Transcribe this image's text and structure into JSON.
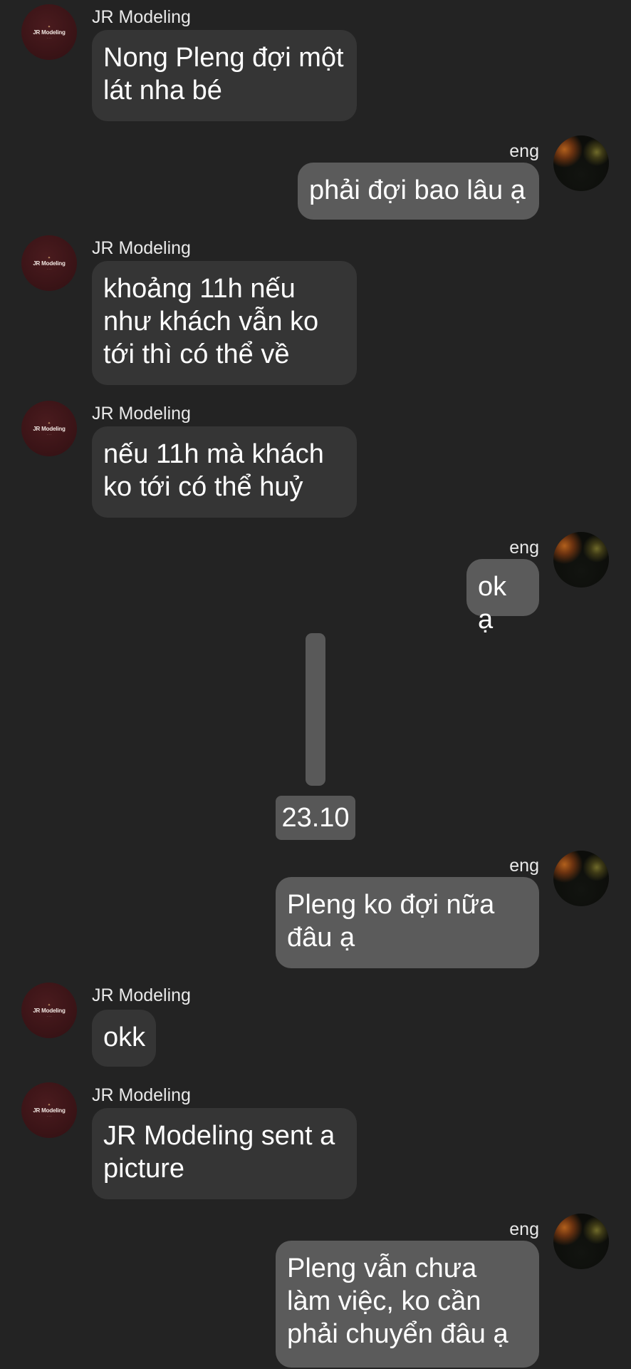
{
  "conversation": {
    "date_divider": "23.10",
    "messages": [
      {
        "sender": "JR Modeling",
        "direction": "in",
        "text": "Nong Pleng đợi một lát nha bé"
      },
      {
        "sender": "eng",
        "direction": "out",
        "text": "phải đợi bao lâu ạ"
      },
      {
        "sender": "JR Modeling",
        "direction": "in",
        "text": "khoảng 11h nếu như khách vẫn ko tới thì có thể về"
      },
      {
        "sender": "JR Modeling",
        "direction": "in",
        "text": "nếu 11h mà khách ko tới có thể huỷ"
      },
      {
        "sender": "eng",
        "direction": "out",
        "text": "ok ạ"
      },
      {
        "sender": "eng",
        "direction": "out",
        "text": "Pleng ko đợi nữa đâu ạ"
      },
      {
        "sender": "JR Modeling",
        "direction": "in",
        "text": "okk"
      },
      {
        "sender": "JR Modeling",
        "direction": "in",
        "text": "JR Modeling sent a picture"
      },
      {
        "sender": "eng",
        "direction": "out",
        "text": "Pleng vẫn chưa làm việc, ko cần phải chuyển đâu ạ"
      }
    ]
  },
  "avatars": {
    "brand_logo_text": "JR Modeling",
    "brand_color": "#3b1417",
    "photo_icon": "user-photo-avatar"
  },
  "colors": {
    "background": "#232323",
    "incoming_bubble": "#353535",
    "outgoing_bubble": "#5b5b5b",
    "scroll_marker": "#595959"
  }
}
